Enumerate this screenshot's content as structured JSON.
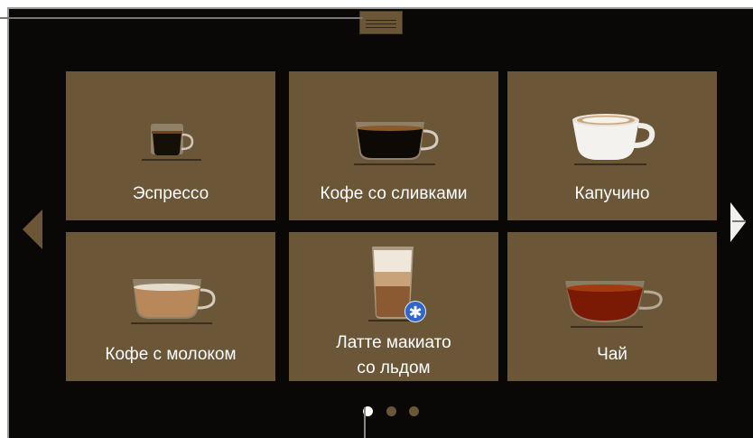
{
  "products": [
    {
      "label": "Эспрессо",
      "cup_icon": "espresso-cup-icon"
    },
    {
      "label": "Кофе со сливками",
      "cup_icon": "coffee-cup-icon"
    },
    {
      "label": "Капучино",
      "cup_icon": "cappuccino-cup-icon"
    },
    {
      "label": "Кофе с молоком",
      "cup_icon": "coffee-with-milk-cup-icon"
    },
    {
      "label_line1": "Латте макиато",
      "label_line2": "со льдом",
      "cup_icon": "latte-glass-icon",
      "badge_icon": "snowflake-icon"
    },
    {
      "label": "Чай",
      "cup_icon": "tea-cup-icon"
    }
  ],
  "pagination": {
    "pages": 3,
    "current": 1
  },
  "colors": {
    "tile": "#6b5638",
    "background": "#0a0806",
    "dot_active": "#ffffff",
    "dot_inactive": "#6b5638",
    "badge": "#2f67c8"
  },
  "icons": {
    "left_arrow": "chevron-left-icon",
    "right_arrow": "chevron-right-icon",
    "top_handle": "pull-down-handle-icon",
    "snowflake": "✱"
  }
}
